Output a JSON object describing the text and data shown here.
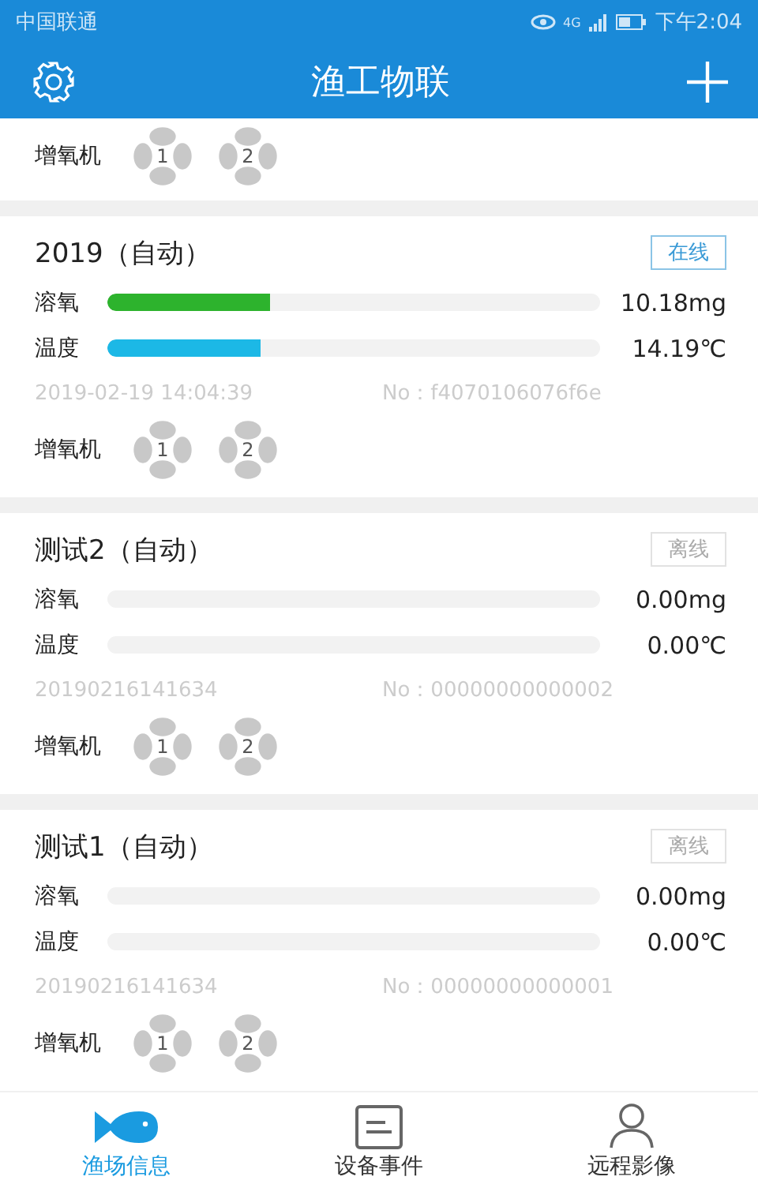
{
  "status_bar": {
    "carrier": "中国联通",
    "network": "4G",
    "time": "下午2:04"
  },
  "header": {
    "title": "渔工物联"
  },
  "partial_card": {
    "aerator_label": "增氧机",
    "fans": [
      "1",
      "2"
    ]
  },
  "devices": [
    {
      "name": "2019（自动）",
      "status": "在线",
      "online": true,
      "meters": [
        {
          "label": "溶氧",
          "level": 0.33,
          "reading": "10.18mg"
        },
        {
          "label": "温度",
          "level": 0.31,
          "reading": "14.19℃"
        }
      ],
      "time": "2019-02-19 14:04:39",
      "no": "No：f4070106076f6e",
      "aerator_label": "增氧机",
      "fans": [
        "1",
        "2"
      ]
    },
    {
      "name": "测试2（自动）",
      "status": "离线",
      "online": false,
      "meters": [
        {
          "label": "溶氧",
          "level": 0,
          "reading": "0.00mg"
        },
        {
          "label": "温度",
          "level": 0,
          "reading": "0.00℃"
        }
      ],
      "time": "20190216141634",
      "no": "No：00000000000002",
      "aerator_label": "增氧机",
      "fans": [
        "1",
        "2"
      ]
    },
    {
      "name": "测试1（自动）",
      "status": "离线",
      "online": false,
      "meters": [
        {
          "label": "溶氧",
          "level": 0,
          "reading": "0.00mg"
        },
        {
          "label": "温度",
          "level": 0,
          "reading": "0.00℃"
        }
      ],
      "time": "20190216141634",
      "no": "No：00000000000001",
      "aerator_label": "增氧机",
      "fans": [
        "1",
        "2"
      ]
    }
  ],
  "tabs": [
    {
      "label": "渔场信息",
      "selected": true
    },
    {
      "label": "设备事件",
      "selected": false
    },
    {
      "label": "远程影像",
      "selected": false
    }
  ]
}
